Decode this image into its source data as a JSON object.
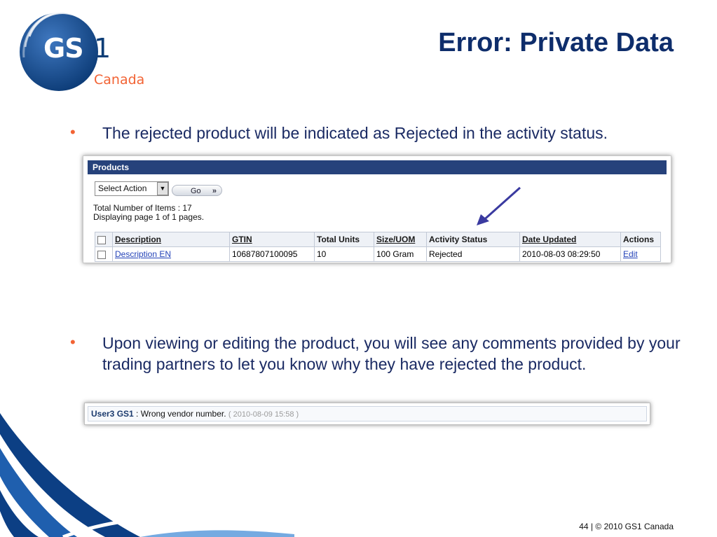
{
  "logo": {
    "name": "GS",
    "one": "1",
    "sub": "Canada"
  },
  "title": "Error: Private Data",
  "bullets": [
    "The rejected product will be indicated as Rejected in the activity status.",
    "Upon viewing or editing the product, you will see any comments provided by your trading partners to let you know why they have rejected the product."
  ],
  "products_panel": {
    "header": "Products",
    "select_action": "Select Action",
    "go_label": "Go",
    "total_items": "Total Number of Items : 17",
    "displaying": "Displaying page 1 of 1 pages.",
    "columns": [
      "Description",
      "GTIN",
      "Total Units",
      "Size/UOM",
      "Activity Status",
      "Date Updated",
      "Actions"
    ],
    "rows": [
      {
        "description": "Description EN",
        "gtin": "10687807100095",
        "total_units": "10",
        "size_uom": "100 Gram",
        "activity_status": "Rejected",
        "date_updated": "2010-08-03 08:29:50",
        "action": "Edit"
      }
    ]
  },
  "comment": {
    "user": "User3 GS1",
    "text": ": Wrong vendor number.",
    "timestamp": "( 2010-08-09 15:58 )"
  },
  "footer": {
    "page": "44",
    "copyright": "| © 2010 GS1 Canada"
  },
  "colors": {
    "navy": "#0e2d6b",
    "orange": "#f26334",
    "panel_header": "#26427b",
    "link": "#2443b8"
  }
}
